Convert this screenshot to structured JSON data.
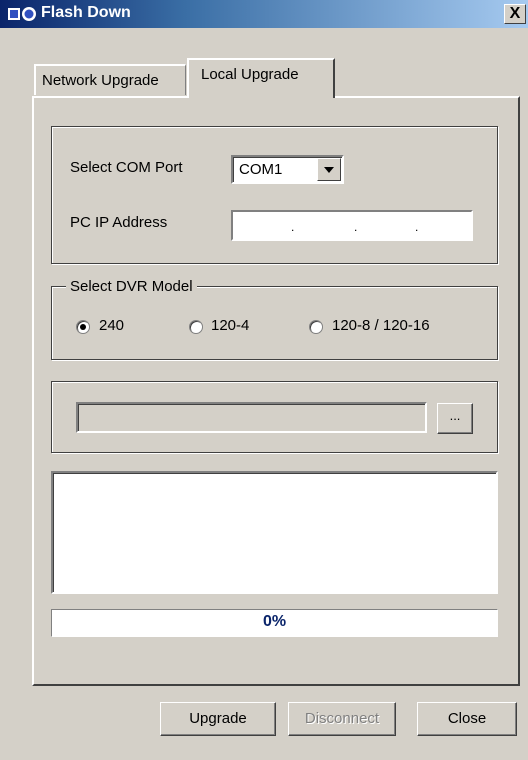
{
  "window": {
    "title": "Flash Down",
    "close_label": "X"
  },
  "tabs": [
    {
      "label": "Network Upgrade",
      "active": false
    },
    {
      "label": "Local Upgrade",
      "active": true
    }
  ],
  "com": {
    "label": "Select COM Port",
    "value": "COM1"
  },
  "ip": {
    "label": "PC IP Address",
    "separators": [
      ".",
      ".",
      "."
    ]
  },
  "dvr": {
    "legend": "Select DVR Model",
    "options": [
      {
        "label": "240",
        "selected": true
      },
      {
        "label": "120-4",
        "selected": false
      },
      {
        "label": "120-8 / 120-16",
        "selected": false
      }
    ]
  },
  "file": {
    "browse_label": "..."
  },
  "progress": {
    "value": 0,
    "text": "0%"
  },
  "buttons": {
    "upgrade": "Upgrade",
    "disconnect": "Disconnect",
    "close": "Close"
  }
}
